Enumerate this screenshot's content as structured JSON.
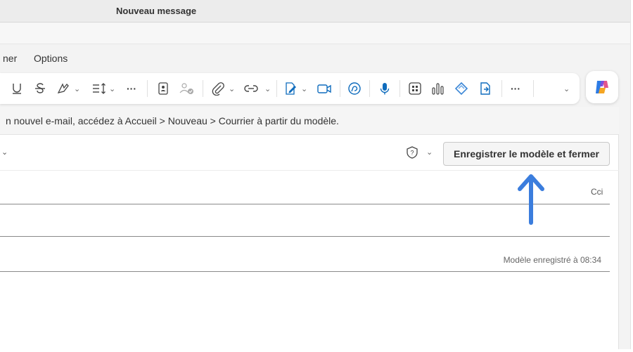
{
  "window": {
    "title": "Nouveau message"
  },
  "menu": {
    "partial_tab": "ner",
    "options_tab": "Options"
  },
  "toolbar": {
    "icons": [
      "underline-icon",
      "strikethrough-icon",
      "highlight-icon",
      "chevron-down-icon",
      "line-spacing-icon",
      "chevron-down-icon",
      "more-icon",
      "contact-card-icon",
      "people-check-icon",
      "attach-icon",
      "chevron-down-icon",
      "link-icon",
      "chevron-down-icon",
      "signature-icon",
      "chevron-down-icon",
      "video-icon",
      "loop-icon",
      "microphone-icon",
      "apps-icon",
      "chart-icon",
      "viva-icon",
      "document-icon",
      "more-icon",
      "chevron-down-icon",
      "copilot-icon"
    ],
    "more_label": "···"
  },
  "info_bar": {
    "text": "n nouvel e-mail, accédez à Accueil > Nouveau > Courrier à partir du modèle."
  },
  "actions": {
    "save_template_close": "Enregistrer le modèle et fermer"
  },
  "fields": {
    "cci_label": "Cci"
  },
  "status": {
    "saved_text": "Modèle enregistré à 08:34"
  },
  "colors": {
    "accent": "#0f6cbd",
    "arrow": "#3b7ddd"
  }
}
